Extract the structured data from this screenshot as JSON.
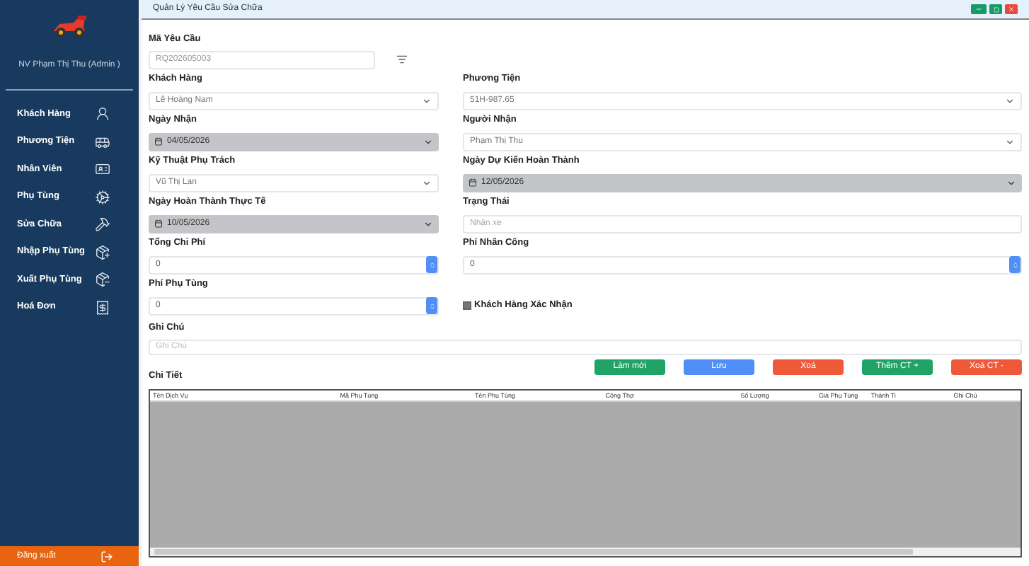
{
  "sidebar": {
    "user": "NV Phạm Thị Thu (Admin )",
    "items": [
      {
        "label": "Khách Hàng"
      },
      {
        "label": "Phương Tiện"
      },
      {
        "label": "Nhân Viên"
      },
      {
        "label": "Phụ Tùng"
      },
      {
        "label": "Sửa Chữa"
      },
      {
        "label": "Nhập Phụ Tùng"
      },
      {
        "label": "Xuất Phụ Tùng"
      },
      {
        "label": "Hoá Đơn"
      }
    ],
    "logout": "Đăng xuất"
  },
  "window": {
    "title": "Quản Lý Yêu Cầu Sửa Chữa"
  },
  "form": {
    "request_id": {
      "label": "Mã Yêu Cầu",
      "value": "RQ202605003",
      "disabled": true
    },
    "rows": [
      [
        {
          "label": "Khách Hàng",
          "kind": "select",
          "value": "Lê Hoàng Nam"
        },
        {
          "label": "Phương Tiện",
          "kind": "select",
          "value": "51H-987.65"
        }
      ],
      [
        {
          "label": "Ngày Nhận",
          "kind": "date",
          "value": "04/05/2026"
        },
        {
          "label": "Người Nhận",
          "kind": "select",
          "value": "Phạm Thị Thu"
        }
      ],
      [
        {
          "label": "Kỹ Thuật Phụ Trách",
          "kind": "select",
          "value": "Vũ Thị Lan"
        },
        {
          "label": "Ngày Dự Kiến Hoàn Thành",
          "kind": "date",
          "value": "12/05/2026"
        }
      ],
      [
        {
          "label": "Ngày Hoàn Thành Thực Tế",
          "kind": "date",
          "value": "10/05/2026"
        },
        {
          "label": "Trạng Thái",
          "kind": "text",
          "placeholder": "Nhận xe"
        }
      ],
      [
        {
          "label": "Tổng Chi Phí",
          "kind": "number",
          "value": "0"
        },
        {
          "label": "Phí Nhân Công",
          "kind": "number",
          "value": "0"
        }
      ],
      [
        {
          "label": "Phí Phụ Tùng",
          "kind": "number",
          "value": "0"
        },
        {
          "label": "Khách Hàng Xác Nhận",
          "kind": "checkbox",
          "checked": false
        }
      ]
    ],
    "note": {
      "label": "Ghi Chú",
      "placeholder": "Ghi Chú"
    }
  },
  "buttons": [
    {
      "label": "Làm mới",
      "color": "#21a366"
    },
    {
      "label": "Lưu",
      "color": "#4f8ff7"
    },
    {
      "label": "Xoá",
      "color": "#f0583a"
    },
    {
      "label": "Thêm CT +",
      "color": "#21a366"
    },
    {
      "label": "Xoá CT -",
      "color": "#f0583a"
    }
  ],
  "details": {
    "title": "Chi Tiết",
    "columns": [
      "Tên Dịch Vụ",
      "Mã Phụ Tùng",
      "Tên Phụ Tùng",
      "Công Thợ",
      "Số Lượng",
      "Giá Phụ Tùng",
      "Thành Ti",
      "Ghi Chú"
    ]
  }
}
